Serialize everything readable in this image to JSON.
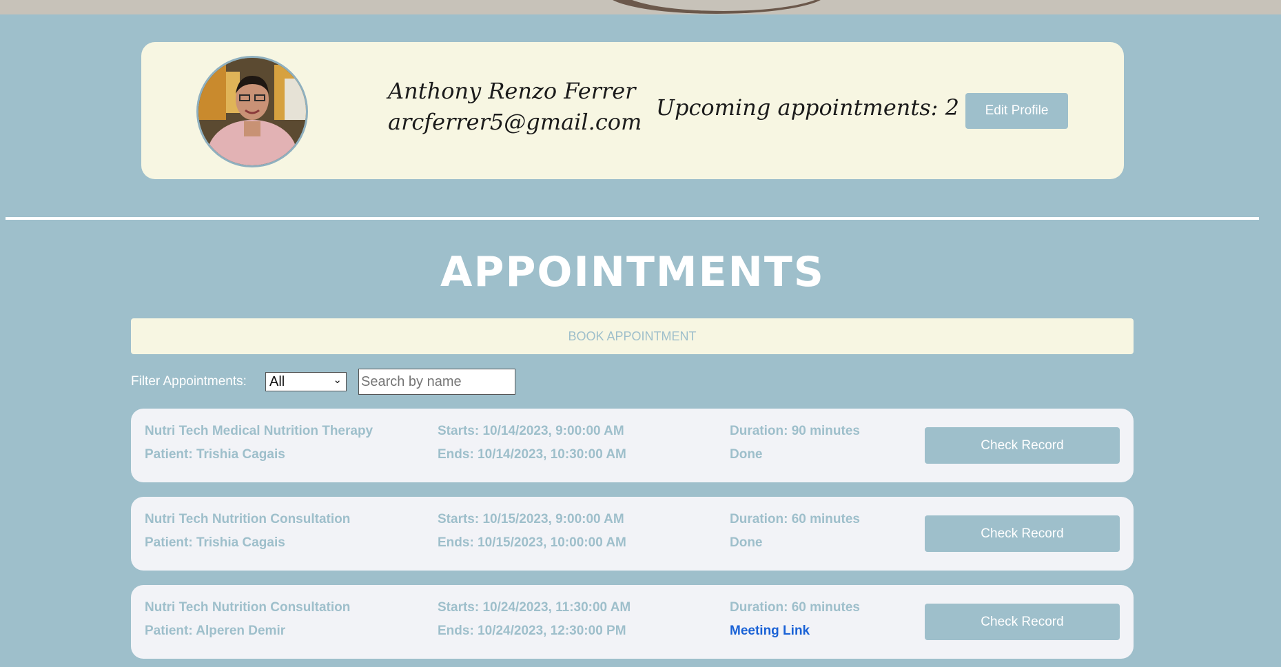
{
  "profile": {
    "name": "Anthony Renzo Ferrer",
    "email": "arcferrer5@gmail.com",
    "upcoming": "Upcoming appointments: 2",
    "edit_label": "Edit Profile"
  },
  "appointments": {
    "title": "APPOINTMENTS",
    "book_label": "BOOK APPOINTMENT",
    "filter_label": "Filter Appointments:",
    "filter_value": "All",
    "search_placeholder": "Search by name",
    "items": [
      {
        "service": "Nutri Tech Medical Nutrition Therapy",
        "patient": "Patient: Trishia Cagais",
        "starts": "Starts: 10/14/2023, 9:00:00 AM",
        "ends": "Ends: 10/14/2023, 10:30:00 AM",
        "duration": "Duration: 90 minutes",
        "status": "Done",
        "button": "Check Record"
      },
      {
        "service": "Nutri Tech Nutrition Consultation",
        "patient": "Patient: Trishia Cagais",
        "starts": "Starts: 10/15/2023, 9:00:00 AM",
        "ends": "Ends: 10/15/2023, 10:00:00 AM",
        "duration": "Duration: 60 minutes",
        "status": "Done",
        "button": "Check Record"
      },
      {
        "service": "Nutri Tech Nutrition Consultation",
        "patient": "Patient: Alperen Demir",
        "starts": "Starts: 10/24/2023, 11:30:00 AM",
        "ends": "Ends: 10/24/2023, 12:30:00 PM",
        "duration": "Duration: 60 minutes",
        "link": "Meeting Link",
        "button": "Check Record"
      }
    ]
  },
  "colors": {
    "page_bg": "#9ebfcb",
    "card_bg": "#f7f6e2",
    "appt_bg": "#f2f3f7",
    "link": "#1a62d6"
  }
}
